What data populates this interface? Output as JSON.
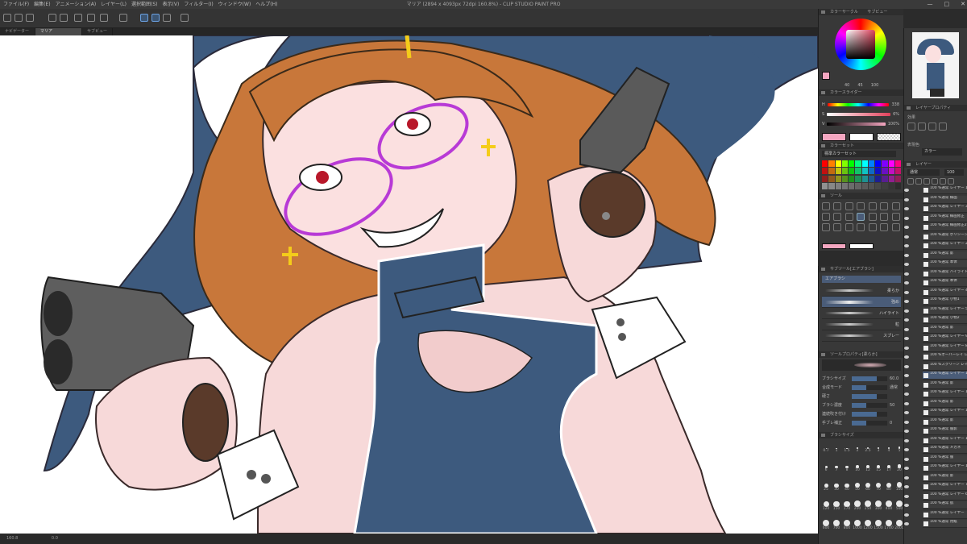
{
  "window": {
    "title": "マリア (2894 x 4093px 72dpi 160.8%) - CLIP STUDIO PAINT PRO",
    "menu": [
      "ファイル(F)",
      "編集(E)",
      "アニメーション(A)",
      "レイヤー(L)",
      "選択範囲(S)",
      "表示(V)",
      "フィルター(I)",
      "ウィンドウ(W)",
      "ヘルプ(H)"
    ],
    "controls": [
      "—",
      "□",
      "✕"
    ]
  },
  "tabs": [
    "ナビゲーター",
    "マリア",
    "サブビュー"
  ],
  "status": {
    "zoom": "160.8",
    "rotation": "0.0"
  },
  "color_panel": {
    "header": "カラーサークル",
    "tab2": "サブビュー",
    "values": [
      "40",
      "45",
      "100"
    ],
    "sliders_header": "カラースライダー",
    "sliders": [
      {
        "label": "H",
        "value": "338"
      },
      {
        "label": "S",
        "value": "6%"
      },
      {
        "label": "V",
        "value": "100%"
      }
    ],
    "main_color": "#f4a6c0",
    "sub_color": "#ffffff"
  },
  "color_set": {
    "header": "カラーセット",
    "name": "標準カラーセット"
  },
  "tools": {
    "header": "ツール"
  },
  "subtool": {
    "header": "サブツール[エアブラシ]",
    "group": "エアブラシ",
    "items": [
      "柔らか",
      "強め",
      "ハイライト",
      "粒",
      "スプレー"
    ]
  },
  "tool_property": {
    "header": "ツールプロパティ[柔らか]",
    "rows": [
      {
        "label": "ブラシサイズ",
        "value": "60.0"
      },
      {
        "label": "合成モード",
        "value": "通常"
      },
      {
        "label": "硬さ",
        "value": ""
      },
      {
        "label": "ブラシ濃度",
        "value": "50"
      },
      {
        "label": "連続吹き付け",
        "value": ""
      },
      {
        "label": "手ブレ補正",
        "value": "0"
      }
    ]
  },
  "brush_size": {
    "header": "ブラシサイズ",
    "sizes": [
      "0.7",
      "1",
      "1.5",
      "2",
      "2.5",
      "3",
      "4",
      "5",
      "6",
      "7",
      "8",
      "10",
      "12",
      "15",
      "17",
      "20",
      "25",
      "30",
      "40",
      "50",
      "60",
      "70",
      "80",
      "100",
      "120",
      "150",
      "170",
      "200",
      "250",
      "300",
      "400",
      "500",
      "600",
      "700",
      "800",
      "1000",
      "1200",
      "1500",
      "1700",
      "2000"
    ]
  },
  "navigator": {
    "header": "ナビゲーター"
  },
  "layer_property": {
    "header": "レイヤープロパティ",
    "effect": "効果",
    "expression": "表現色",
    "expression_value": "カラー"
  },
  "layers": {
    "header": "レイヤー",
    "blend": "通常",
    "opacity": "100",
    "items": [
      "100 %通常 レイヤー 1",
      "100 %通常 線画",
      "100 %通常 レイヤー 3",
      "100 %通常 線画修正",
      "100 %通常 線画修正2",
      "100 %通常 ポリシーン",
      "100 %通常 レイヤー 2",
      "100 %通常 影",
      "100 %通常 本体",
      "100 %通常 ハイライト",
      "100 %通常 本体",
      "100 %通常 レイヤー 4",
      "100 %通常 小物1",
      "100 %通常 レイヤー 5",
      "100 %通常 小物2",
      "100 %通常 影",
      "100 %通常 レイヤー 9",
      "100 %通常 レイヤー 8",
      "100 %オーバーレイ レイヤー 18",
      "100 %スクリーン レイヤー 15",
      "100 %通常 レイヤー 14",
      "100 %通常 影",
      "100 %通常 レイヤー 13",
      "100 %通常 影",
      "100 %通常 レイヤー 12",
      "100 %通常 影",
      "100 %通常 服影",
      "100 %通常 レイヤー 11",
      "100 %通常 メガネ",
      "100 %通常 服",
      "100 %通常 レイヤー 10",
      "100 %通常 影",
      "100 %通常 レイヤー 7",
      "100 %通常 レイヤー 6",
      "100 %通常 肌",
      "100 %通常 レイヤー",
      "100 %通常 用紙"
    ]
  }
}
